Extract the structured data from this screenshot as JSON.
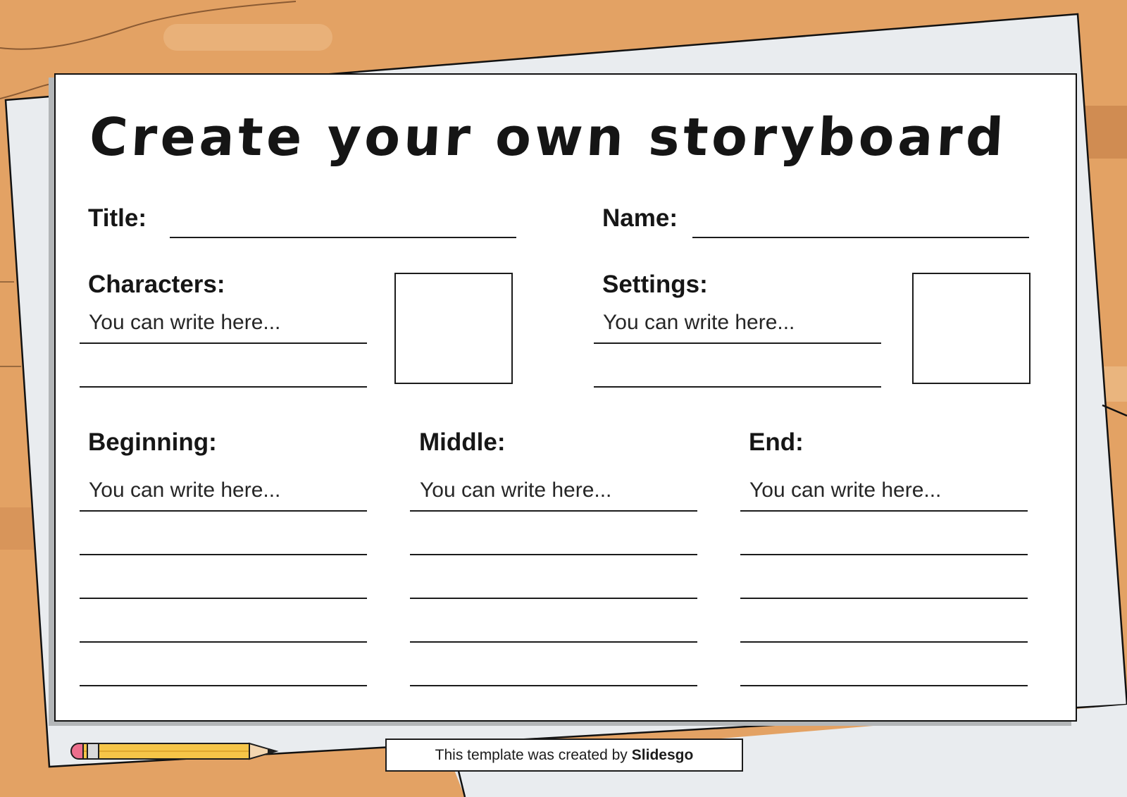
{
  "page_title": "Create your own storyboard",
  "fields": {
    "title_label": "Title:",
    "name_label": "Name:"
  },
  "characters": {
    "label": "Characters:",
    "hint": "You can write here..."
  },
  "settings": {
    "label": "Settings:",
    "hint": "You can write here..."
  },
  "beginning": {
    "label": "Beginning:",
    "hint": "You can write here..."
  },
  "middle": {
    "label": "Middle:",
    "hint": "You can write here..."
  },
  "end": {
    "label": "End:",
    "hint": "You can write here..."
  },
  "footer": {
    "text": "This template was created by",
    "brand": "Slidesgo"
  },
  "colors": {
    "desk": "#e3a264",
    "paper_back": "#e9ecef",
    "ink": "#1b1b1b",
    "pencil_body": "#f6c548",
    "eraser": "#ec6e8c"
  },
  "icons": [
    "pencil-icon"
  ]
}
